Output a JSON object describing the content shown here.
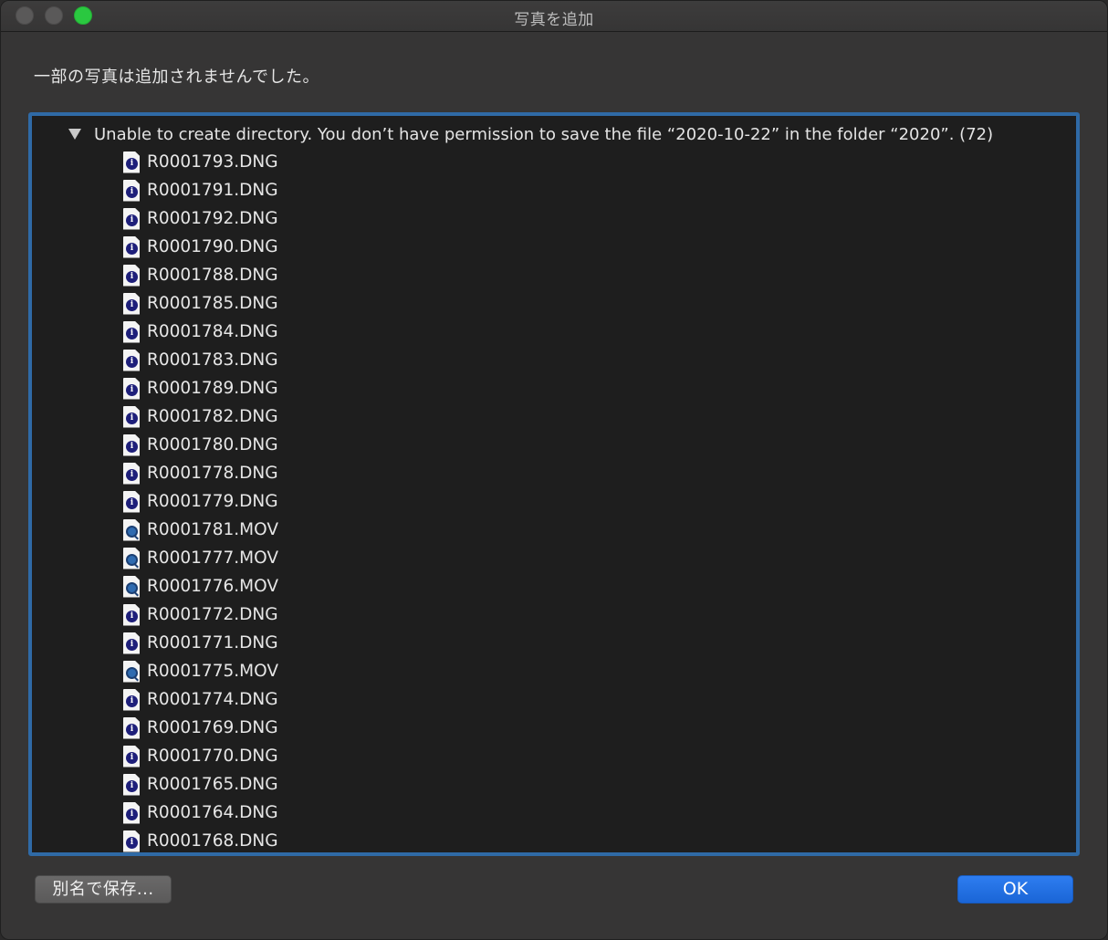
{
  "window": {
    "title": "写真を追加"
  },
  "message": "一部の写真は追加されませんでした。",
  "error_group": {
    "label": "Unable to create directory. You don’t have permission to save the file “2020-10-22” in the folder “2020”. (72)",
    "expanded": true
  },
  "files": [
    {
      "name": "R0001793.DNG",
      "icon": "dng-file-icon"
    },
    {
      "name": "R0001791.DNG",
      "icon": "dng-file-icon"
    },
    {
      "name": "R0001792.DNG",
      "icon": "dng-file-icon"
    },
    {
      "name": "R0001790.DNG",
      "icon": "dng-file-icon"
    },
    {
      "name": "R0001788.DNG",
      "icon": "dng-file-icon"
    },
    {
      "name": "R0001785.DNG",
      "icon": "dng-file-icon"
    },
    {
      "name": "R0001784.DNG",
      "icon": "dng-file-icon"
    },
    {
      "name": "R0001783.DNG",
      "icon": "dng-file-icon"
    },
    {
      "name": "R0001789.DNG",
      "icon": "dng-file-icon"
    },
    {
      "name": "R0001782.DNG",
      "icon": "dng-file-icon"
    },
    {
      "name": "R0001780.DNG",
      "icon": "dng-file-icon"
    },
    {
      "name": "R0001778.DNG",
      "icon": "dng-file-icon"
    },
    {
      "name": "R0001779.DNG",
      "icon": "dng-file-icon"
    },
    {
      "name": "R0001781.MOV",
      "icon": "mov-file-icon"
    },
    {
      "name": "R0001777.MOV",
      "icon": "mov-file-icon"
    },
    {
      "name": "R0001776.MOV",
      "icon": "mov-file-icon"
    },
    {
      "name": "R0001772.DNG",
      "icon": "dng-file-icon"
    },
    {
      "name": "R0001771.DNG",
      "icon": "dng-file-icon"
    },
    {
      "name": "R0001775.MOV",
      "icon": "mov-file-icon"
    },
    {
      "name": "R0001774.DNG",
      "icon": "dng-file-icon"
    },
    {
      "name": "R0001769.DNG",
      "icon": "dng-file-icon"
    },
    {
      "name": "R0001770.DNG",
      "icon": "dng-file-icon"
    },
    {
      "name": "R0001765.DNG",
      "icon": "dng-file-icon"
    },
    {
      "name": "R0001764.DNG",
      "icon": "dng-file-icon"
    },
    {
      "name": "R0001768.DNG",
      "icon": "dng-file-icon"
    }
  ],
  "buttons": {
    "save_as": "別名で保存...",
    "ok": "OK"
  },
  "colors": {
    "accent": "#2f6aa6",
    "ok_button": "#1f6fe6",
    "zoom_button": "#2ac840"
  }
}
